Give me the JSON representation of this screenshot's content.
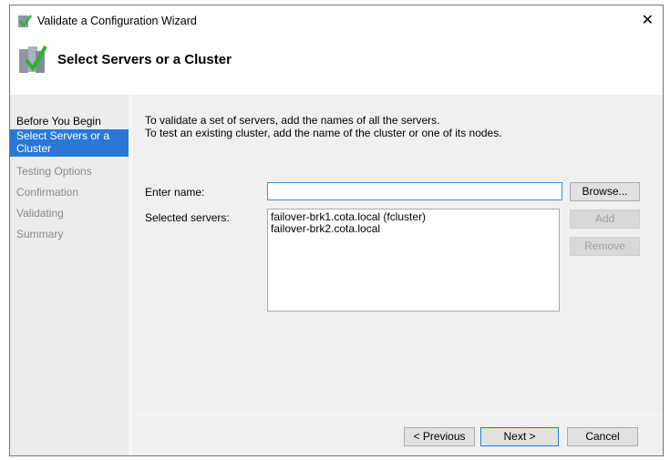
{
  "window": {
    "title": "Validate a Configuration Wizard",
    "close": "✕"
  },
  "header": {
    "title": "Select Servers or a Cluster"
  },
  "sidebar": {
    "items": [
      {
        "label": "Before You Begin"
      },
      {
        "label": "Select Servers or a Cluster"
      },
      {
        "label": "Testing Options"
      },
      {
        "label": "Confirmation"
      },
      {
        "label": "Validating"
      },
      {
        "label": "Summary"
      }
    ]
  },
  "main": {
    "intro1": "To validate a set of servers, add the names of all the servers.",
    "intro2": "To test an existing cluster, add the name of the cluster or one of its nodes.",
    "enter_name_label": "Enter name:",
    "enter_name_value": "",
    "selected_label": "Selected servers:",
    "servers": [
      "failover-brk1.cota.local (fcluster)",
      "failover-brk2.cota.local"
    ],
    "browse": "Browse...",
    "add": "Add",
    "remove": "Remove"
  },
  "footer": {
    "previous": "< Previous",
    "next": "Next >",
    "cancel": "Cancel"
  }
}
